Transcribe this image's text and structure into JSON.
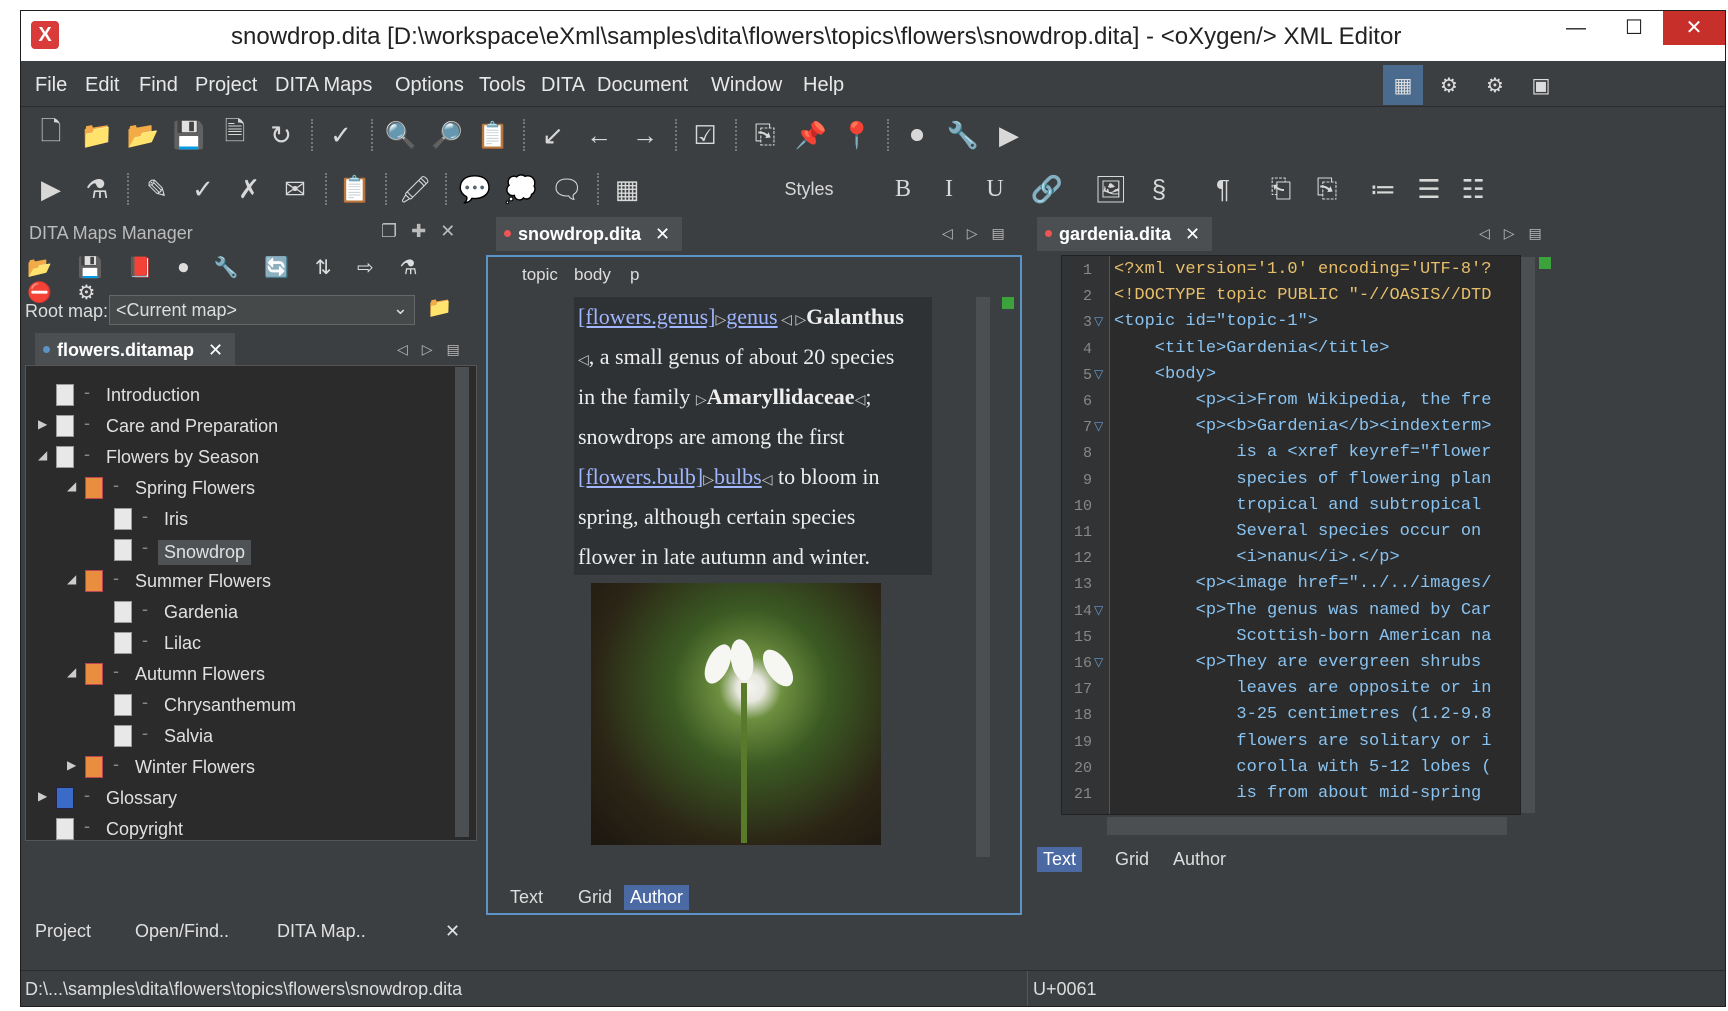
{
  "window": {
    "title": "snowdrop.dita [D:\\workspace\\eXml\\samples\\dita\\flowers\\topics\\flowers\\snowdrop.dita] - <oXygen/> XML Editor",
    "app_icon": "X",
    "minimize": "—",
    "maximize": "☐",
    "close": "✕"
  },
  "menu": [
    "File",
    "Edit",
    "Find",
    "Project",
    "DITA Maps",
    "Options",
    "Tools",
    "DITA",
    "Document",
    "Window",
    "Help"
  ],
  "toolbar2": {
    "styles_label": "Styles",
    "bold": "B",
    "italic": "I",
    "underline": "U",
    "section": "§",
    "pilcrow": "¶"
  },
  "maps_manager": {
    "title": "DITA Maps Manager",
    "root_label": "Root map:",
    "root_value": "<Current map>",
    "map_tab": "flowers.ditamap",
    "tree": [
      {
        "label": "Introduction",
        "level": 0,
        "icon": "topic-icon",
        "expander": ""
      },
      {
        "label": "Care and Preparation",
        "level": 0,
        "icon": "topic-icon",
        "expander": "▶"
      },
      {
        "label": "Flowers by Season",
        "level": 0,
        "icon": "topic-icon",
        "expander": "◢"
      },
      {
        "label": "Spring Flowers",
        "level": 1,
        "icon": "map-icon",
        "expander": "◢"
      },
      {
        "label": "Iris",
        "level": 2,
        "icon": "topic-icon",
        "expander": ""
      },
      {
        "label": "Snowdrop",
        "level": 2,
        "icon": "topic-icon",
        "expander": "",
        "selected": true
      },
      {
        "label": "Summer Flowers",
        "level": 1,
        "icon": "map-icon",
        "expander": "◢"
      },
      {
        "label": "Gardenia",
        "level": 2,
        "icon": "topic-icon",
        "expander": ""
      },
      {
        "label": "Lilac",
        "level": 2,
        "icon": "topic-icon",
        "expander": ""
      },
      {
        "label": "Autumn Flowers",
        "level": 1,
        "icon": "map-icon",
        "expander": "◢"
      },
      {
        "label": "Chrysanthemum",
        "level": 2,
        "icon": "topic-icon",
        "expander": ""
      },
      {
        "label": "Salvia",
        "level": 2,
        "icon": "topic-icon",
        "expander": ""
      },
      {
        "label": "Winter Flowers",
        "level": 1,
        "icon": "map-icon",
        "expander": "▶"
      },
      {
        "label": "Glossary",
        "level": 0,
        "icon": "glossary-icon",
        "expander": "▶"
      },
      {
        "label": "Copyright",
        "level": 0,
        "icon": "topic-icon",
        "expander": ""
      }
    ],
    "footer_tabs": [
      "Project",
      "Open/Find..",
      "DITA Map.."
    ]
  },
  "editor_left": {
    "tab": "snowdrop.dita",
    "breadcrumbs": [
      "topic",
      "body",
      "p"
    ],
    "lines": [
      "[flowers.genus]|genus|Galanthus",
      ", a small genus of about 20 species",
      "in the family |Amaryllidaceae|;",
      "snowdrops are among the first",
      "[flowers.bulb]|bulbs| to bloom in",
      "spring, although certain species",
      "flower in late autumn and winter."
    ],
    "bottom_tabs": [
      "Text",
      "Grid",
      "Author"
    ],
    "active_bottom_tab": "Author"
  },
  "editor_right": {
    "tab": "gardenia.dita",
    "code": [
      "<?xml version='1.0' encoding='UTF-8'?",
      "<!DOCTYPE topic PUBLIC \"-//OASIS//DTD",
      "<topic id=\"topic-1\">",
      "    <title>Gardenia</title>",
      "    <body>",
      "        <p><i>From Wikipedia, the fre",
      "        <p><b>Gardenia</b><indexterm>",
      "            is a <xref keyref=\"flower",
      "            species of flowering plan",
      "            tropical and subtropical",
      "            Several species occur on",
      "            <i>nanu</i>.</p>",
      "        <p><image href=\"../../images/",
      "        <p>The genus was named by Car",
      "            Scottish-born American na",
      "        <p>They are evergreen shrubs",
      "            leaves are opposite or in",
      "            3-25 centimetres (1.2-9.8",
      "            flowers are solitary or i",
      "            corolla with 5-12 lobes (",
      "            is from about mid-spring"
    ],
    "folds": [
      3,
      5,
      7,
      14,
      16
    ],
    "bottom_tabs": [
      "Text",
      "Grid",
      "Author"
    ],
    "active_bottom_tab": "Text"
  },
  "status": {
    "path": "D:\\...\\samples\\dita\\flowers\\topics\\flowers\\snowdrop.dita",
    "char": "U+0061"
  }
}
